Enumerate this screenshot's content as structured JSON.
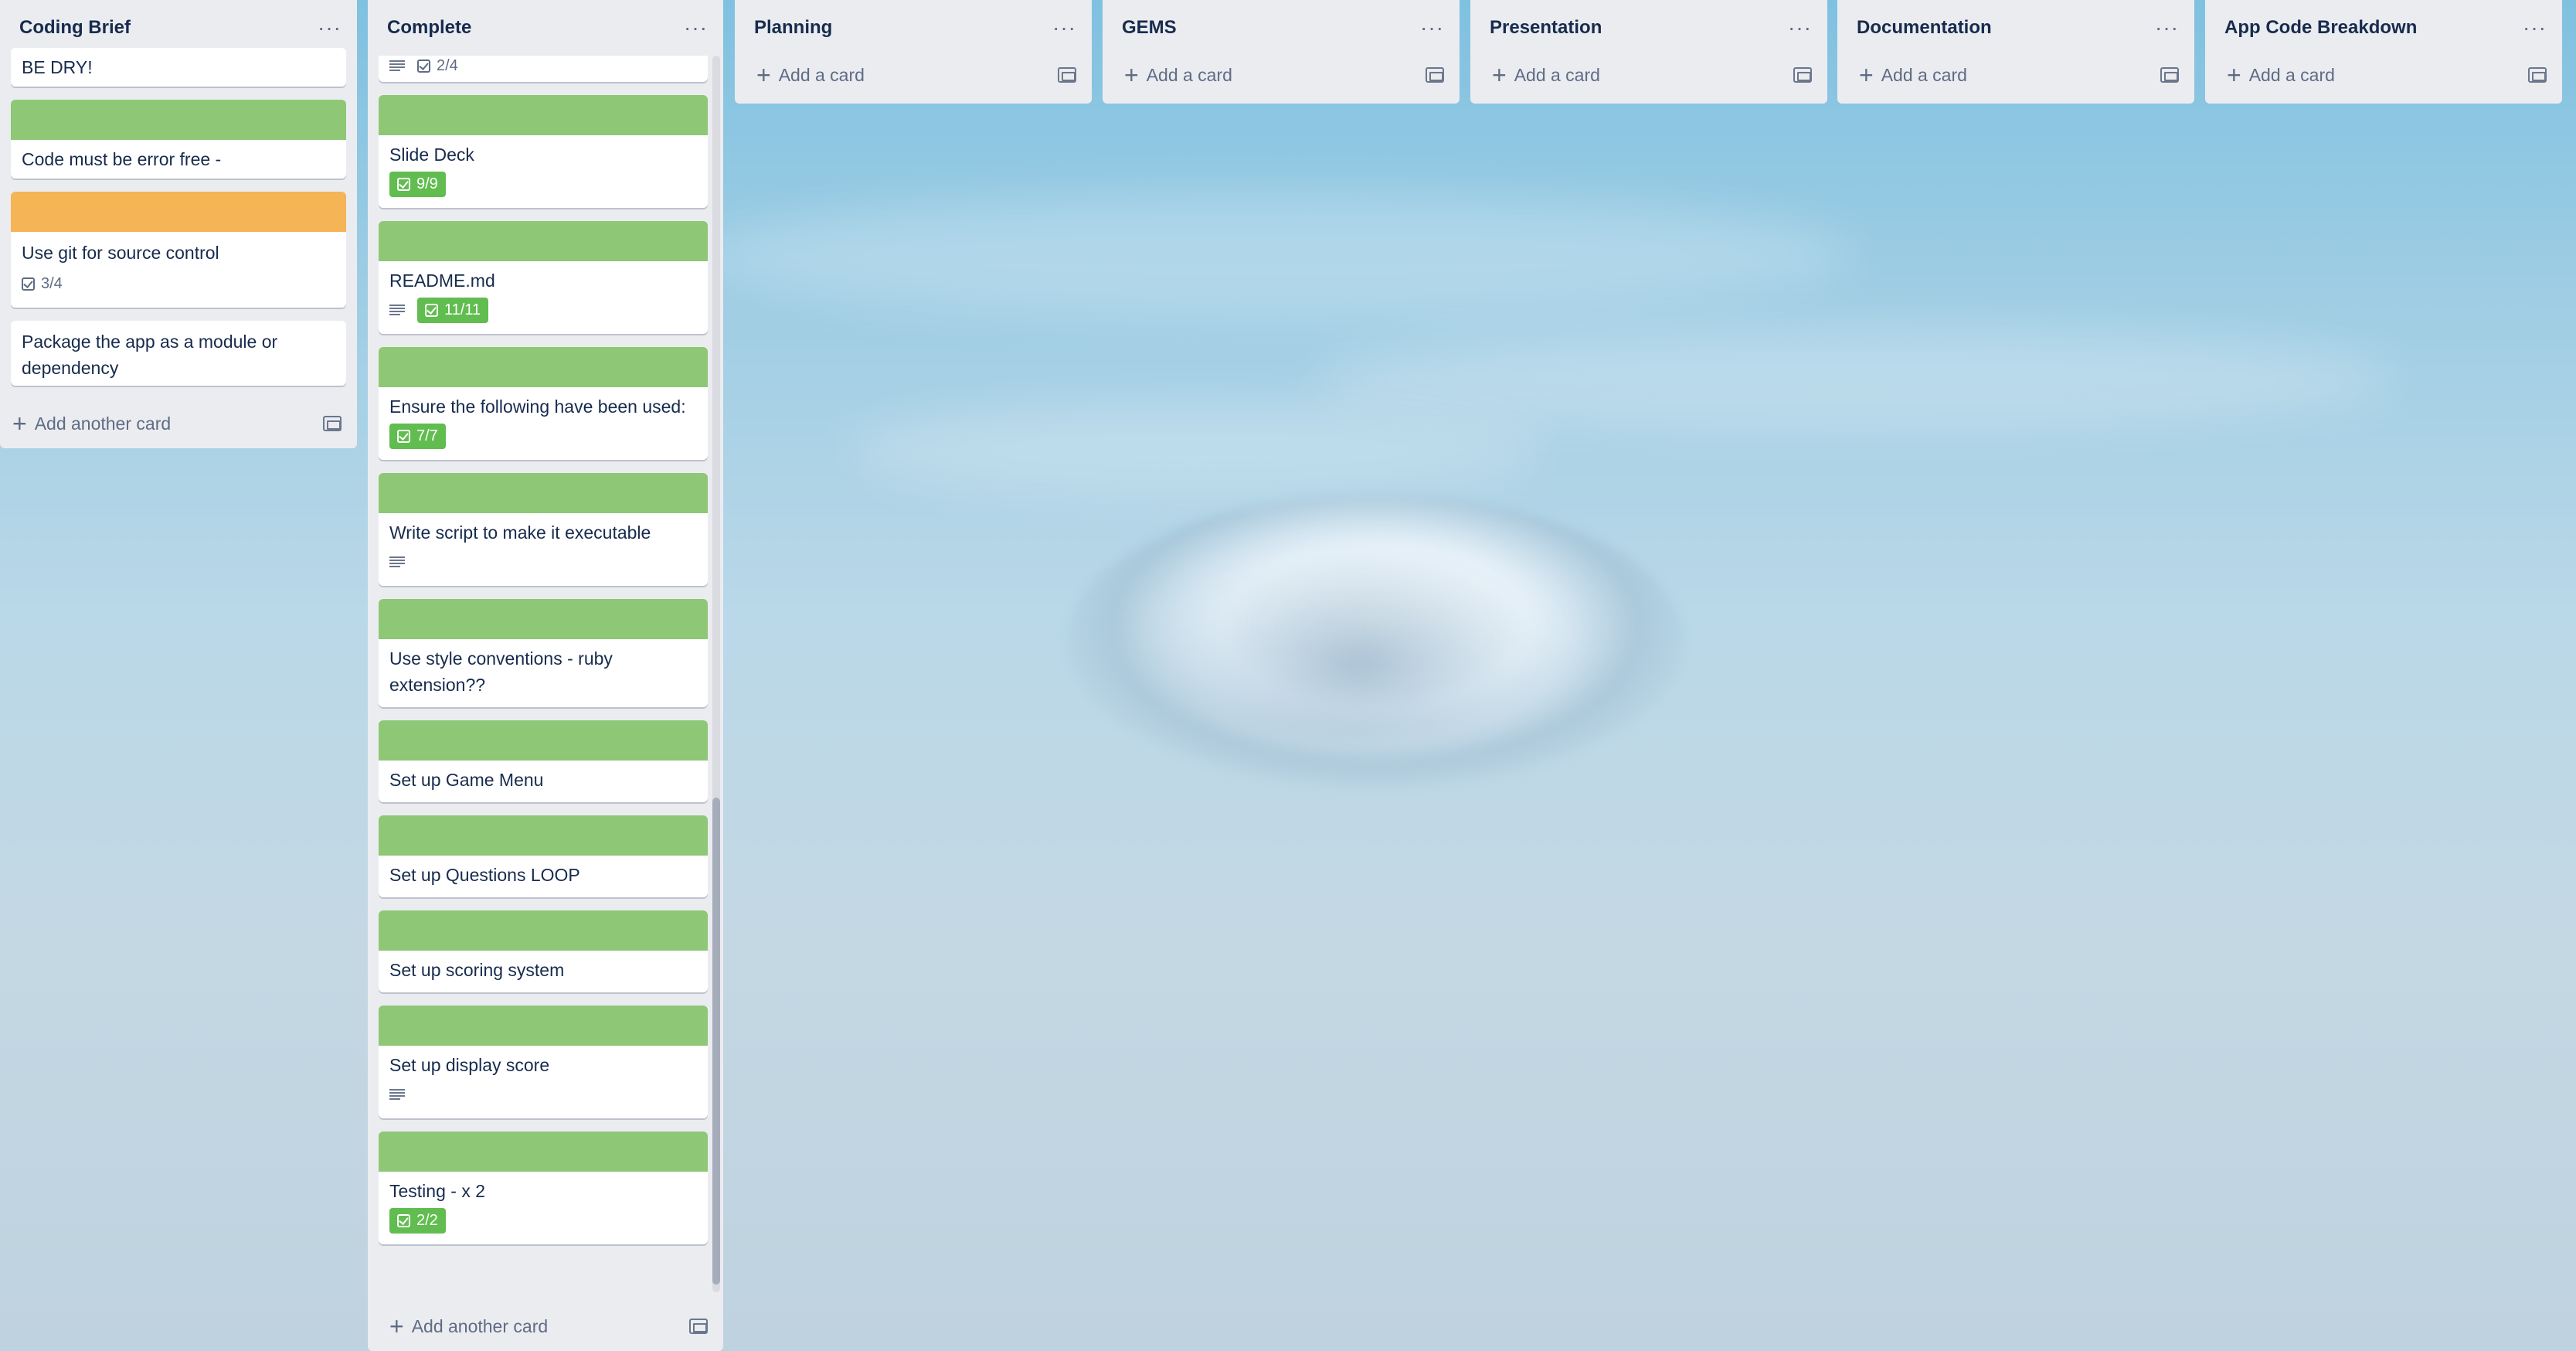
{
  "colors": {
    "green_label": "#8ec775",
    "orange_label": "#f5b455",
    "badge_done": "#61bd4f",
    "list_bg": "#ebecf0"
  },
  "add_another_card": "Add another card",
  "add_a_card": "Add a card",
  "menu_glyph": "···",
  "lists": {
    "coding_brief": {
      "title": "Coding Brief",
      "cards": [
        {
          "title": "BE DRY!"
        },
        {
          "title": "Code must be error free -",
          "cover": "green"
        },
        {
          "title": "Use git for source control",
          "cover": "orange",
          "checklist": "3/4"
        },
        {
          "title": "Package the app as a module or dependency"
        }
      ]
    },
    "complete": {
      "title": "Complete",
      "partial_card": {
        "checklist": "2/4"
      },
      "cards": [
        {
          "title": "Slide Deck",
          "checklist": "9/9"
        },
        {
          "title": "README.md",
          "checklist": "11/11"
        },
        {
          "title": "Ensure the following have been used:",
          "checklist": "7/7"
        },
        {
          "title": "Write script to make it executable"
        },
        {
          "title": "Use style conventions - ruby extension??"
        },
        {
          "title": "Set up Game Menu"
        },
        {
          "title": "Set up Questions LOOP"
        },
        {
          "title": "Set up scoring system"
        },
        {
          "title": "Set up display score"
        },
        {
          "title": "Testing - x 2",
          "checklist": "2/2"
        }
      ]
    },
    "planning": {
      "title": "Planning"
    },
    "gems": {
      "title": "GEMS"
    },
    "presentation": {
      "title": "Presentation"
    },
    "documentation": {
      "title": "Documentation"
    },
    "app_code": {
      "title": "App Code Breakdown"
    }
  }
}
